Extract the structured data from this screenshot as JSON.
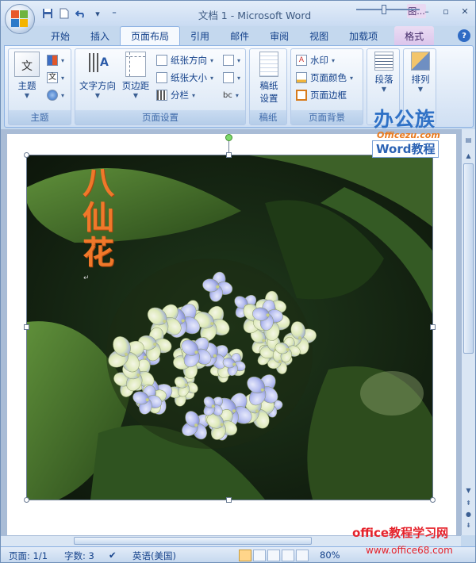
{
  "window": {
    "title": "文档 1 - Microsoft Word",
    "context_tab_group": "图..."
  },
  "qat": {
    "save": "save-icon",
    "new": "new-document-icon",
    "undo": "undo-icon",
    "customize": "customize-qat-icon"
  },
  "tabs": [
    {
      "label": "开始"
    },
    {
      "label": "插入"
    },
    {
      "label": "页面布局",
      "active": true
    },
    {
      "label": "引用"
    },
    {
      "label": "邮件"
    },
    {
      "label": "审阅"
    },
    {
      "label": "视图"
    },
    {
      "label": "加载项"
    },
    {
      "label": "格式",
      "contextual": true
    }
  ],
  "ribbon": {
    "themes": {
      "group_label": "主题",
      "themes_button": "主题",
      "theme_icon_label": "文",
      "colors_icon": "theme-colors-icon",
      "fonts_icon_label": "文",
      "effects_icon": "theme-effects-icon"
    },
    "page_setup": {
      "group_label": "页面设置",
      "text_direction": "文字方向",
      "margins": "页边距",
      "orientation": "纸张方向",
      "size": "纸张大小",
      "columns": "分栏",
      "breaks_icon": "breaks-icon",
      "line_numbers_icon": "line-numbers-icon",
      "hyphenation_label": "bc"
    },
    "draft_paper": {
      "group_label": "稿纸",
      "settings_line1": "稿纸",
      "settings_line2": "设置"
    },
    "page_background": {
      "group_label": "页面背景",
      "watermark": "水印",
      "page_color": "页面颜色",
      "page_borders": "页面边框"
    },
    "paragraph": {
      "label": "段落"
    },
    "arrange": {
      "label": "排列"
    }
  },
  "brand_logo": {
    "name": "办公族",
    "url": "Officezu.com",
    "tag": "Word教程"
  },
  "document": {
    "art_text": [
      "八",
      "仙",
      "花"
    ]
  },
  "statusbar": {
    "page": "页面: 1/1",
    "words": "字数: 3",
    "language": "英语(美国)",
    "zoom": "80%"
  },
  "watermark": {
    "site": "office教程学习网",
    "url": "www.office68.com"
  },
  "colors": {
    "ribbon_bg": "#dbe7f6",
    "art_text": "#f0782a",
    "watermark_red": "#e5222b",
    "brand_blue": "#2f71c6"
  }
}
